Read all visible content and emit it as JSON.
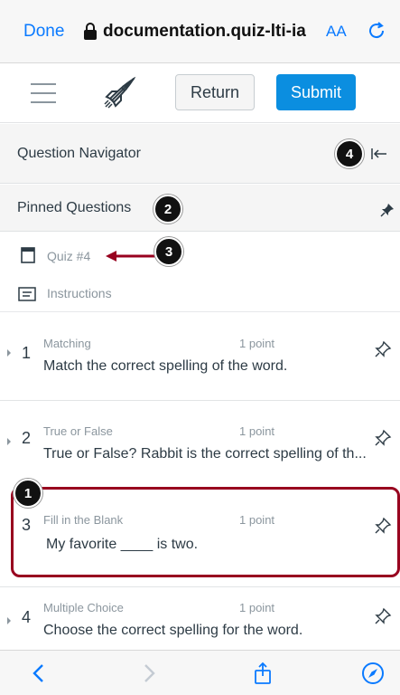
{
  "browser": {
    "done_label": "Done",
    "url": "documentation.quiz-lti-ia",
    "text_size_label": "AA",
    "icons": [
      "lock-icon",
      "reload-icon",
      "back-icon",
      "forward-icon",
      "share-icon",
      "compass-icon"
    ]
  },
  "toolbar": {
    "return_label": "Return",
    "submit_label": "Submit",
    "icons": [
      "hamburger-icon",
      "rocket-icon"
    ]
  },
  "navigator": {
    "title": "Question Navigator",
    "pinned_title": "Pinned Questions",
    "quiz_label": "Quiz #4",
    "instructions_label": "Instructions"
  },
  "callouts": [
    "1",
    "2",
    "3",
    "4"
  ],
  "questions": [
    {
      "number": "1",
      "type": "Matching",
      "points": "1 point",
      "text": "Match the correct spelling of the word."
    },
    {
      "number": "2",
      "type": "True or False",
      "points": "1 point",
      "text": "True or False?  Rabbit is the correct spelling of th..."
    },
    {
      "number": "3",
      "type": "Fill in the Blank",
      "points": "1 point",
      "text": "My favorite ____ is two."
    },
    {
      "number": "4",
      "type": "Multiple Choice",
      "points": "1 point",
      "text": "Choose the correct spelling for the word."
    }
  ],
  "colors": {
    "ios_blue": "#0a7aff",
    "submit_blue": "#0b8ee0",
    "highlight_red": "#98021f",
    "muted_text": "#8b969e"
  }
}
